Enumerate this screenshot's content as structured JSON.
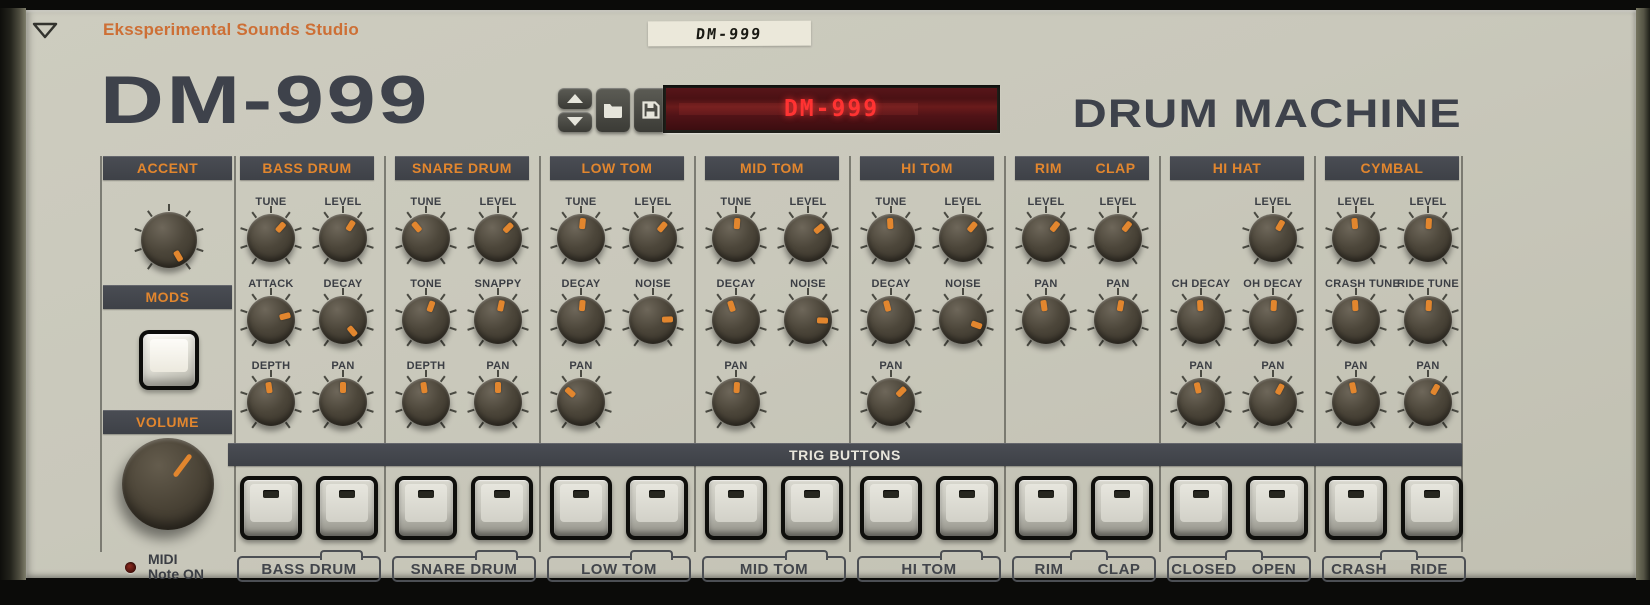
{
  "header": {
    "brand": "Ekssperimental Sounds Studio",
    "tape_label": "DM-999",
    "logo": "DM-999",
    "product": "DRUM MACHINE",
    "lcd_text": "DM-999",
    "corner_icon": "triangle-down",
    "toolbar": {
      "up_icon": "arrow-up",
      "down_icon": "arrow-down",
      "open_icon": "folder",
      "save_icon": "floppy-disk"
    }
  },
  "left_column": {
    "accent": {
      "title": "ACCENT",
      "knob_angle": 150
    },
    "mods": {
      "title": "MODS"
    },
    "volume": {
      "title": "VOLUME",
      "knob_angle": 37
    },
    "midi": {
      "line1": "MIDI",
      "line2": "Note ON",
      "led_color": "#5a1410"
    }
  },
  "trig": {
    "bar_label": "TRIG BUTTONS",
    "buttons_per_group": 2
  },
  "sections": [
    {
      "titles": [
        "BASS DRUM"
      ],
      "bottom_labels": [
        "BASS DRUM"
      ],
      "knobs": [
        [
          {
            "label": "TUNE",
            "angle": 42
          },
          {
            "label": "LEVEL",
            "angle": 32
          }
        ],
        [
          {
            "label": "ATTACK",
            "angle": 75
          },
          {
            "label": "DECAY",
            "angle": 140
          }
        ],
        [
          {
            "label": "DEPTH",
            "angle": -8
          },
          {
            "label": "PAN",
            "angle": 0
          }
        ]
      ]
    },
    {
      "titles": [
        "SNARE DRUM"
      ],
      "bottom_labels": [
        "SNARE DRUM"
      ],
      "knobs": [
        [
          {
            "label": "TUNE",
            "angle": -40
          },
          {
            "label": "LEVEL",
            "angle": 45
          }
        ],
        [
          {
            "label": "TONE",
            "angle": 20
          },
          {
            "label": "SNAPPY",
            "angle": 12
          }
        ],
        [
          {
            "label": "DEPTH",
            "angle": -8
          },
          {
            "label": "PAN",
            "angle": 0
          }
        ]
      ]
    },
    {
      "titles": [
        "LOW TOM"
      ],
      "bottom_labels": [
        "LOW TOM"
      ],
      "knobs": [
        [
          {
            "label": "TUNE",
            "angle": 6
          },
          {
            "label": "LEVEL",
            "angle": 40
          }
        ],
        [
          {
            "label": "DECAY",
            "angle": 5
          },
          {
            "label": "NOISE",
            "angle": 88
          }
        ],
        [
          {
            "label": "PAN",
            "angle": -48
          },
          null
        ]
      ]
    },
    {
      "titles": [
        "MID TOM"
      ],
      "bottom_labels": [
        "MID TOM"
      ],
      "knobs": [
        [
          {
            "label": "TUNE",
            "angle": 4
          },
          {
            "label": "LEVEL",
            "angle": 50
          }
        ],
        [
          {
            "label": "DECAY",
            "angle": -18
          },
          {
            "label": "NOISE",
            "angle": 92
          }
        ],
        [
          {
            "label": "PAN",
            "angle": 3
          },
          null
        ]
      ]
    },
    {
      "titles": [
        "HI TOM"
      ],
      "bottom_labels": [
        "HI TOM"
      ],
      "knobs": [
        [
          {
            "label": "TUNE",
            "angle": -3
          },
          {
            "label": "LEVEL",
            "angle": 40
          }
        ],
        [
          {
            "label": "DECAY",
            "angle": -15
          },
          {
            "label": "NOISE",
            "angle": 110
          }
        ],
        [
          {
            "label": "PAN",
            "angle": 45
          },
          null
        ]
      ]
    },
    {
      "titles": [
        "RIM",
        "CLAP"
      ],
      "bottom_labels": [
        "RIM",
        "CLAP"
      ],
      "knobs": [
        [
          {
            "label": "LEVEL",
            "angle": 38
          },
          {
            "label": "LEVEL",
            "angle": 38
          }
        ],
        [
          {
            "label": "PAN",
            "angle": -8
          },
          {
            "label": "PAN",
            "angle": 10
          }
        ],
        [
          null,
          null
        ]
      ]
    },
    {
      "titles": [
        "HI HAT"
      ],
      "bottom_labels": [
        "CLOSED",
        "OPEN"
      ],
      "knobs": [
        [
          null,
          {
            "label": "LEVEL",
            "angle": 30
          }
        ],
        [
          {
            "label": "CH DECAY",
            "angle": -3
          },
          {
            "label": "OH DECAY",
            "angle": 3
          }
        ],
        [
          {
            "label": "PAN",
            "angle": -13
          },
          {
            "label": "PAN",
            "angle": 28
          }
        ]
      ]
    },
    {
      "titles": [
        "CYMBAL"
      ],
      "bottom_labels": [
        "CRASH",
        "RIDE"
      ],
      "knobs": [
        [
          {
            "label": "LEVEL",
            "angle": -5
          },
          {
            "label": "LEVEL",
            "angle": 3
          }
        ],
        [
          {
            "label": "CRASH TUNE",
            "angle": -3
          },
          {
            "label": "RIDE TUNE",
            "angle": 3
          }
        ],
        [
          {
            "label": "PAN",
            "angle": -12
          },
          {
            "label": "PAN",
            "angle": 30
          }
        ]
      ]
    }
  ],
  "colors": {
    "panel": "#c9c8bb",
    "header_bar": "#42454b",
    "accent_orange": "#e2862e",
    "brand_orange": "#cd6f35",
    "logo_gray": "#3e424b",
    "lcd_background": "#4a1215",
    "lcd_text_red": "#ff3030",
    "knob_body": "#4c463a",
    "button_cap": "#d6d5cc"
  }
}
